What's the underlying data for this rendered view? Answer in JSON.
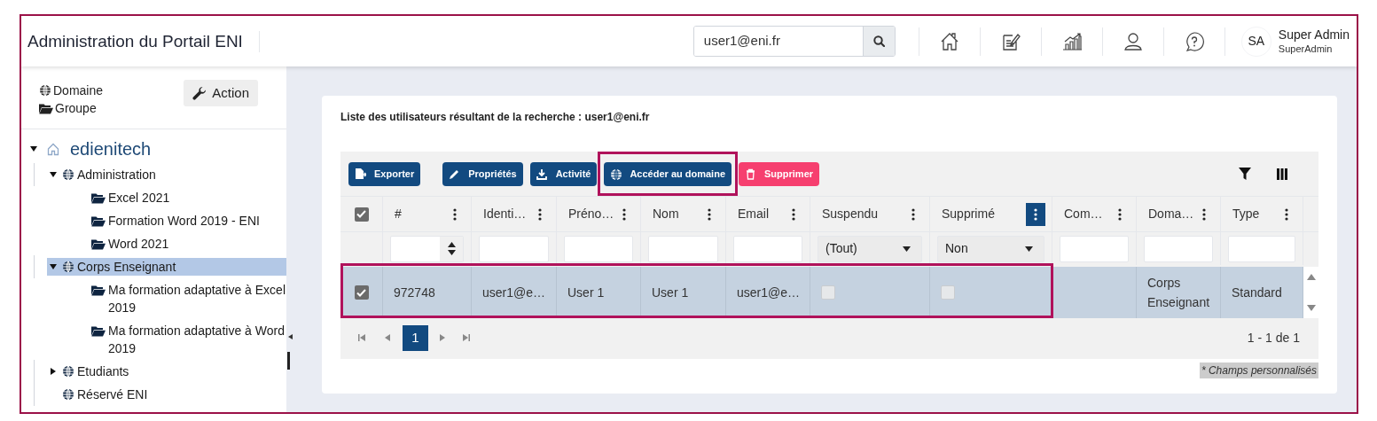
{
  "header": {
    "title": "Administration du Portail ENI",
    "search": {
      "value": "user1@eni.fr"
    },
    "user": {
      "initials": "SA",
      "name": "Super Admin",
      "role": "SuperAdmin"
    }
  },
  "sidebar": {
    "legend": [
      {
        "kind": "domain",
        "label": "Domaine"
      },
      {
        "kind": "group",
        "label": "Groupe"
      }
    ],
    "action_button": "Action",
    "tree": [
      {
        "kind": "home",
        "label": "edienitech",
        "expanded": true,
        "selected": false,
        "children": [
          {
            "kind": "domain",
            "label": "Administration",
            "expanded": true,
            "selected": false,
            "children": [
              {
                "kind": "group",
                "label": "Excel 2021",
                "selected": false
              },
              {
                "kind": "group",
                "label": "Formation Word 2019 - ENI",
                "selected": false
              },
              {
                "kind": "group",
                "label": "Word 2021",
                "selected": false
              }
            ]
          },
          {
            "kind": "domain",
            "label": "Corps Enseignant",
            "expanded": true,
            "selected": true,
            "children": [
              {
                "kind": "group",
                "label": "Ma formation adaptative à Excel 2019",
                "selected": false
              },
              {
                "kind": "group",
                "label": "Ma formation adaptative à Word 2019",
                "selected": false
              }
            ]
          },
          {
            "kind": "domain",
            "label": "Etudiants",
            "expanded": false,
            "selected": false
          },
          {
            "kind": "domain",
            "label": "Réservé ENI",
            "selected": false
          }
        ]
      }
    ]
  },
  "results": {
    "caption": "Liste des utilisateurs résultant de la recherche : user1@eni.fr",
    "toolbar": [
      {
        "kind": "export",
        "label": "Exporter",
        "highlighted": false
      },
      {
        "kind": "edit",
        "label": "Propriétés",
        "highlighted": false
      },
      {
        "kind": "download",
        "label": "Activité",
        "highlighted": false
      },
      {
        "kind": "globe",
        "label": "Accéder au domaine",
        "highlighted": true
      },
      {
        "kind": "delete",
        "label": "Supprimer",
        "highlighted": false
      }
    ],
    "columns": [
      {
        "label": "#",
        "menu_active": false,
        "filter": {
          "kind": "number"
        }
      },
      {
        "label": "Identi…",
        "menu_active": false,
        "filter": {
          "kind": "text"
        }
      },
      {
        "label": "Préno…",
        "menu_active": false,
        "filter": {
          "kind": "text"
        }
      },
      {
        "label": "Nom",
        "menu_active": false,
        "filter": {
          "kind": "text"
        }
      },
      {
        "label": "Email",
        "menu_active": false,
        "filter": {
          "kind": "text"
        }
      },
      {
        "label": "Suspendu",
        "menu_active": false,
        "filter": {
          "kind": "select",
          "value": "(Tout)"
        }
      },
      {
        "label": "Supprimé",
        "menu_active": true,
        "filter": {
          "kind": "select",
          "value": "Non"
        }
      },
      {
        "label": "Com…",
        "menu_active": false,
        "filter": {
          "kind": "text"
        }
      },
      {
        "label": "Doma…",
        "menu_active": false,
        "filter": {
          "kind": "text"
        }
      },
      {
        "label": "Type",
        "menu_active": false,
        "filter": {
          "kind": "text"
        }
      }
    ],
    "all_checked": true,
    "rows": [
      {
        "selected": true,
        "highlighted": true,
        "cells": [
          {
            "kind": "text",
            "text": "972748"
          },
          {
            "kind": "text",
            "text": "user1@e…"
          },
          {
            "kind": "text",
            "text": "User 1"
          },
          {
            "kind": "text",
            "text": "User 1"
          },
          {
            "kind": "text",
            "text": "user1@e…"
          },
          {
            "kind": "checkbox",
            "checked": false
          },
          {
            "kind": "checkbox",
            "checked": false
          },
          {
            "kind": "blank"
          },
          {
            "kind": "text",
            "text": "Corps Enseignant"
          },
          {
            "kind": "text",
            "text": "Standard"
          }
        ]
      }
    ],
    "pages": [
      {
        "label": "1",
        "selected": true
      }
    ],
    "summary": "1 - 1 de 1",
    "footnote": "* Champs personnalisés"
  }
}
